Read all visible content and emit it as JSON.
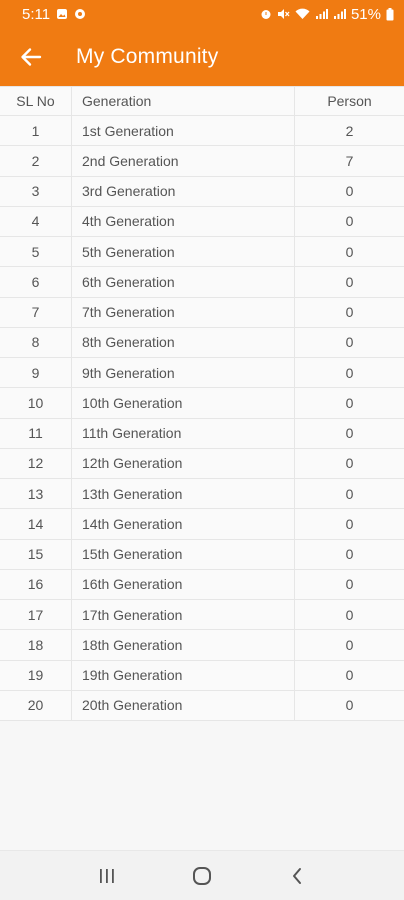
{
  "status_bar": {
    "time": "5:11",
    "battery": "51%",
    "icons": [
      "gallery-icon",
      "settings-alt-icon",
      "alarm-icon",
      "mute-icon",
      "wifi-icon",
      "signal-icon",
      "signal-icon-2",
      "battery-icon"
    ]
  },
  "app_bar": {
    "title": "My Community",
    "back_icon": "arrow-left-icon",
    "color": "#f07b12"
  },
  "table": {
    "headers": {
      "sl": "SL No",
      "generation": "Generation",
      "person": "Person"
    },
    "rows": [
      {
        "sl": "1",
        "generation": "1st Generation",
        "person": "2"
      },
      {
        "sl": "2",
        "generation": "2nd Generation",
        "person": "7"
      },
      {
        "sl": "3",
        "generation": "3rd Generation",
        "person": "0"
      },
      {
        "sl": "4",
        "generation": "4th Generation",
        "person": "0"
      },
      {
        "sl": "5",
        "generation": "5th Generation",
        "person": "0"
      },
      {
        "sl": "6",
        "generation": "6th Generation",
        "person": "0"
      },
      {
        "sl": "7",
        "generation": "7th Generation",
        "person": "0"
      },
      {
        "sl": "8",
        "generation": "8th Generation",
        "person": "0"
      },
      {
        "sl": "9",
        "generation": "9th Generation",
        "person": "0"
      },
      {
        "sl": "10",
        "generation": "10th Generation",
        "person": "0"
      },
      {
        "sl": "11",
        "generation": "11th Generation",
        "person": "0"
      },
      {
        "sl": "12",
        "generation": "12th Generation",
        "person": "0"
      },
      {
        "sl": "13",
        "generation": "13th Generation",
        "person": "0"
      },
      {
        "sl": "14",
        "generation": "14th Generation",
        "person": "0"
      },
      {
        "sl": "15",
        "generation": "15th Generation",
        "person": "0"
      },
      {
        "sl": "16",
        "generation": "16th Generation",
        "person": "0"
      },
      {
        "sl": "17",
        "generation": "17th Generation",
        "person": "0"
      },
      {
        "sl": "18",
        "generation": "18th Generation",
        "person": "0"
      },
      {
        "sl": "19",
        "generation": "19th Generation",
        "person": "0"
      },
      {
        "sl": "20",
        "generation": "20th Generation",
        "person": "0"
      }
    ]
  },
  "nav_bar": {
    "icons": [
      "recent-apps-icon",
      "home-icon",
      "back-icon"
    ]
  }
}
